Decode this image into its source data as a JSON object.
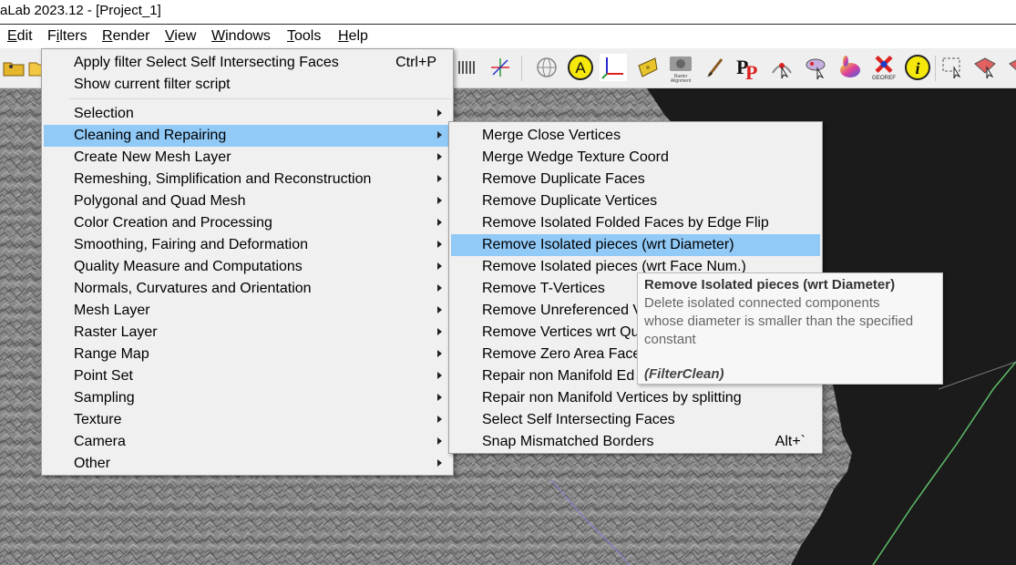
{
  "window": {
    "title": "aLab 2023.12 - [Project_1]"
  },
  "menubar": {
    "items": [
      {
        "label": "Edit",
        "underline": "E"
      },
      {
        "label": "Filters",
        "underline": "i"
      },
      {
        "label": "Render",
        "underline": "R"
      },
      {
        "label": "View",
        "underline": "V"
      },
      {
        "label": "Windows",
        "underline": "W"
      },
      {
        "label": "Tools",
        "underline": "T"
      },
      {
        "label": "Help",
        "underline": "H"
      }
    ]
  },
  "toolbar": {
    "icons": [
      "open-project-icon",
      "open-folder-icon",
      "layer-dots-icon",
      "axis-triad-icon",
      "sphere-icon",
      "annotation-a-icon",
      "axes-icon",
      "cheese-icon",
      "camera-icon",
      "paintbrush-icon",
      "pickpoints-icon",
      "vertex-select-icon",
      "align-icon",
      "color-bunny-icon",
      "georef-icon",
      "info-icon",
      "select-rect-icon",
      "select-faces-icon",
      "select-verts-icon"
    ],
    "labels": {
      "raster_alignment": "Raster\nAlignment",
      "georef": "GEOREF"
    }
  },
  "filters_menu": {
    "top_items": [
      {
        "label": "Apply filter Select Self Intersecting Faces",
        "shortcut": "Ctrl+P"
      },
      {
        "label": "Show current filter script",
        "shortcut": ""
      }
    ],
    "categories": [
      {
        "label": "Selection",
        "highlighted": false
      },
      {
        "label": "Cleaning and Repairing",
        "highlighted": true
      },
      {
        "label": "Create New Mesh Layer",
        "highlighted": false
      },
      {
        "label": "Remeshing, Simplification and Reconstruction",
        "highlighted": false
      },
      {
        "label": "Polygonal and Quad Mesh",
        "highlighted": false
      },
      {
        "label": "Color Creation and Processing",
        "highlighted": false
      },
      {
        "label": "Smoothing, Fairing and Deformation",
        "highlighted": false
      },
      {
        "label": "Quality Measure and Computations",
        "highlighted": false
      },
      {
        "label": "Normals, Curvatures and Orientation",
        "highlighted": false
      },
      {
        "label": "Mesh Layer",
        "highlighted": false
      },
      {
        "label": "Raster Layer",
        "highlighted": false
      },
      {
        "label": "Range Map",
        "highlighted": false
      },
      {
        "label": "Point Set",
        "highlighted": false
      },
      {
        "label": "Sampling",
        "highlighted": false
      },
      {
        "label": "Texture",
        "highlighted": false
      },
      {
        "label": "Camera",
        "highlighted": false
      },
      {
        "label": "Other",
        "highlighted": false
      }
    ]
  },
  "cleaning_menu": {
    "items": [
      {
        "label": "Merge Close Vertices",
        "shortcut": "",
        "highlighted": false
      },
      {
        "label": "Merge Wedge Texture Coord",
        "shortcut": "",
        "highlighted": false
      },
      {
        "label": "Remove Duplicate Faces",
        "shortcut": "",
        "highlighted": false
      },
      {
        "label": "Remove Duplicate Vertices",
        "shortcut": "",
        "highlighted": false
      },
      {
        "label": "Remove Isolated Folded Faces by Edge Flip",
        "shortcut": "",
        "highlighted": false
      },
      {
        "label": "Remove Isolated pieces (wrt Diameter)",
        "shortcut": "",
        "highlighted": true
      },
      {
        "label": "Remove Isolated pieces (wrt Face Num.)",
        "shortcut": "",
        "highlighted": false
      },
      {
        "label": "Remove T-Vertices",
        "shortcut": "",
        "highlighted": false
      },
      {
        "label": "Remove Unreferenced V",
        "shortcut": "",
        "highlighted": false
      },
      {
        "label": "Remove Vertices wrt Qu",
        "shortcut": "",
        "highlighted": false
      },
      {
        "label": "Remove Zero Area Face",
        "shortcut": "",
        "highlighted": false
      },
      {
        "label": "Repair non Manifold Ed",
        "shortcut": "",
        "highlighted": false
      },
      {
        "label": "Repair non Manifold Vertices by splitting",
        "shortcut": "",
        "highlighted": false
      },
      {
        "label": "Select Self Intersecting Faces",
        "shortcut": "",
        "highlighted": false
      },
      {
        "label": "Snap Mismatched Borders",
        "shortcut": "Alt+`",
        "highlighted": false
      }
    ]
  },
  "tooltip": {
    "title": "Remove Isolated pieces (wrt Diameter)",
    "description_lines": [
      "Delete isolated connected components",
      "whose diameter is smaller than the specified",
      "constant"
    ],
    "plugin": "(FilterClean)"
  },
  "colors": {
    "menu_bg": "#f0f0f0",
    "highlight": "#91c9f7",
    "tooltip_bg": "#f7f7f7",
    "mesh_gray": "#8a8a8a",
    "viewport_bg": "#1b1b1b",
    "green_line": "#5fbf6a",
    "purple_line": "#8a80c8"
  }
}
